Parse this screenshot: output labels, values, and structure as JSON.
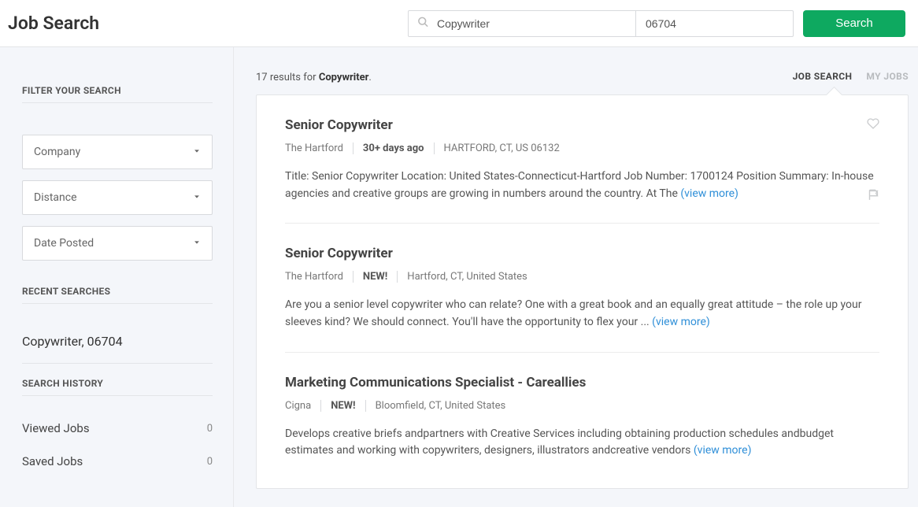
{
  "header": {
    "title": "Job Search",
    "keyword": "Copywriter",
    "location": "06704",
    "search_button": "Search"
  },
  "sidebar": {
    "filter_title": "FILTER YOUR SEARCH",
    "filters": {
      "company": "Company",
      "distance": "Distance",
      "date_posted": "Date Posted"
    },
    "recent_title": "RECENT SEARCHES",
    "recent_item": "Copywriter, 06704",
    "history_title": "SEARCH HISTORY",
    "history": {
      "viewed_label": "Viewed Jobs",
      "viewed_count": "0",
      "saved_label": "Saved Jobs",
      "saved_count": "0"
    }
  },
  "results": {
    "count_prefix": "17 results for ",
    "count_term": "Copywriter",
    "count_suffix": ".",
    "tab_search": "JOB SEARCH",
    "tab_myjobs": "MY JOBS",
    "view_more": "(view more)"
  },
  "jobs": [
    {
      "title": "Senior Copywriter",
      "company": "The Hartford",
      "badge": "30+ days ago",
      "location": "HARTFORD, CT, US 06132",
      "desc": "Title: Senior Copywriter Location: United States-Connecticut-Hartford Job Number: 1700124 Position Summary: In-house agencies and creative groups are growing in numbers around the country. At The "
    },
    {
      "title": "Senior Copywriter",
      "company": "The Hartford",
      "badge": "NEW!",
      "location": "Hartford, CT, United States",
      "desc": "Are you a senior level copywriter who can relate? One with a great book and an equally great attitude – the role up your sleeves kind? We should connect. You'll have the opportunity to flex your ... "
    },
    {
      "title": "Marketing Communications Specialist - Careallies",
      "company": "Cigna",
      "badge": "NEW!",
      "location": "Bloomfield, CT, United States",
      "desc": "Develops creative briefs andpartners with Creative Services including obtaining production schedules andbudget estimates and working with copywriters, designers, illustrators andcreative vendors "
    }
  ]
}
